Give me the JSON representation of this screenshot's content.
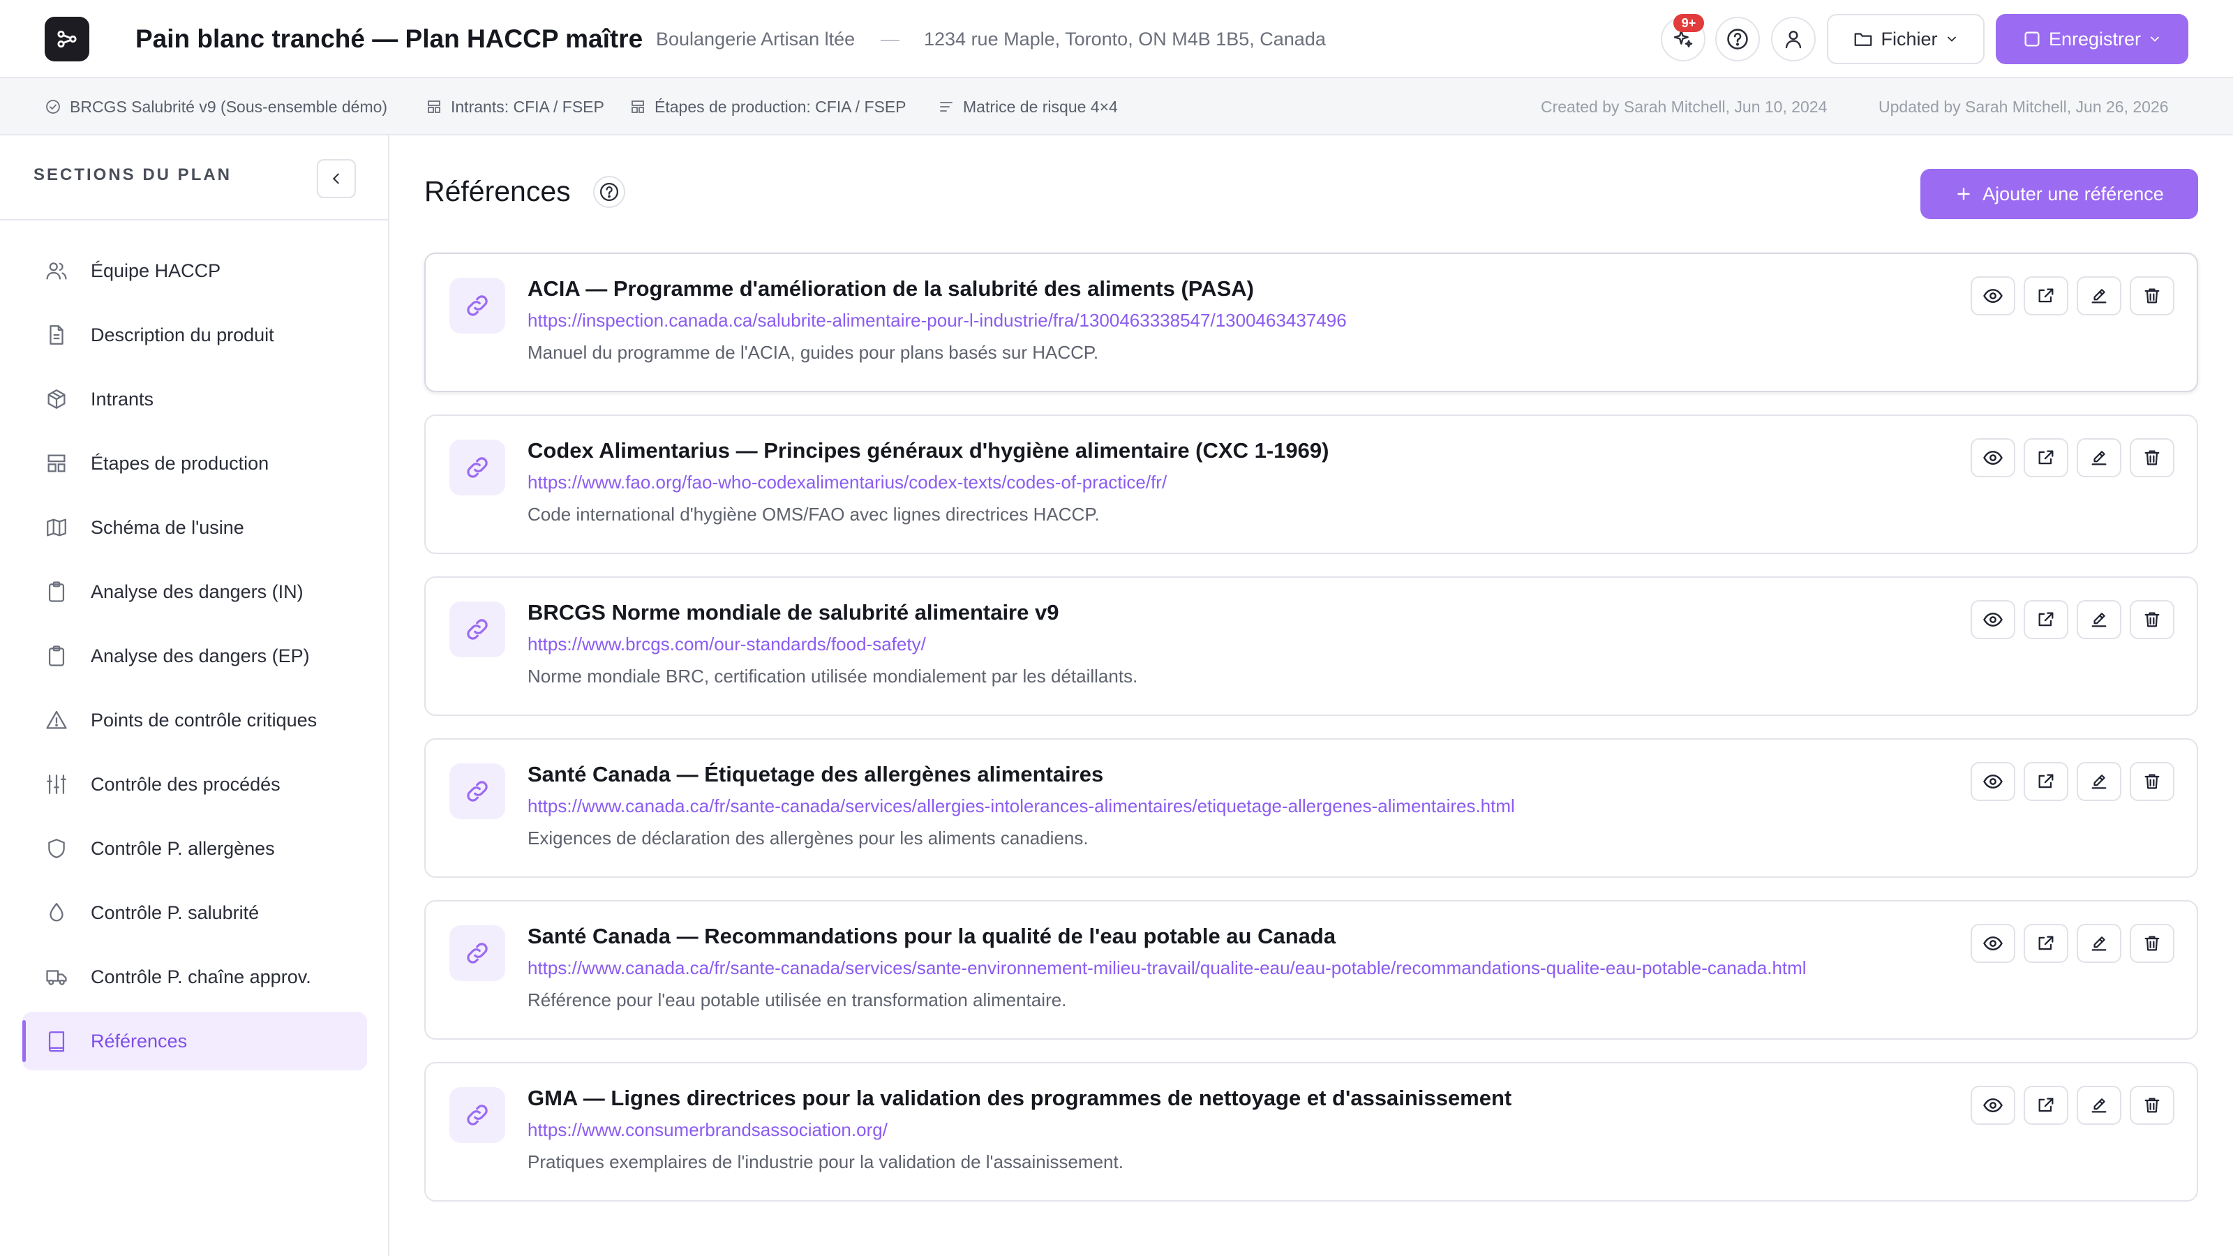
{
  "header": {
    "title": "Pain blanc tranché — Plan HACCP maître",
    "company": "Boulangerie Artisan ltée",
    "separator": "—",
    "address": "1234 rue Maple, Toronto, ON M4B 1B5, Canada",
    "notification_count": "9+",
    "file_label": "Fichier",
    "save_label": "Enregistrer"
  },
  "meta": {
    "standard": "BRCGS Salubrité v9 (Sous-ensemble démo)",
    "intrants": "Intrants: CFIA / FSEP",
    "etapes": "Étapes de production: CFIA / FSEP",
    "matrix": "Matrice de risque 4×4",
    "created": "Created by Sarah Mitchell, Jun 10, 2024",
    "updated": "Updated by Sarah Mitchell, Jun 26, 2026"
  },
  "sidebar": {
    "title": "SECTIONS DU PLAN",
    "items": [
      {
        "label": "Équipe HACCP",
        "icon": "users-icon"
      },
      {
        "label": "Description du produit",
        "icon": "document-icon"
      },
      {
        "label": "Intrants",
        "icon": "box-icon"
      },
      {
        "label": "Étapes de production",
        "icon": "layout-icon"
      },
      {
        "label": "Schéma de l'usine",
        "icon": "map-icon"
      },
      {
        "label": "Analyse des dangers (IN)",
        "icon": "clipboard-icon"
      },
      {
        "label": "Analyse des dangers (EP)",
        "icon": "clipboard-icon"
      },
      {
        "label": "Points de contrôle critiques",
        "icon": "warning-icon"
      },
      {
        "label": "Contrôle des procédés",
        "icon": "sliders-icon"
      },
      {
        "label": "Contrôle P. allergènes",
        "icon": "shield-icon"
      },
      {
        "label": "Contrôle P. salubrité",
        "icon": "droplet-icon"
      },
      {
        "label": "Contrôle P. chaîne approv.",
        "icon": "truck-icon"
      },
      {
        "label": "Références",
        "icon": "book-icon",
        "active": true
      }
    ]
  },
  "main": {
    "title": "Références",
    "add_label": "Ajouter une référence",
    "references": [
      {
        "title": "ACIA — Programme d'amélioration de la salubrité des aliments (PASA)",
        "url": "https://inspection.canada.ca/salubrite-alimentaire-pour-l-industrie/fra/1300463338547/1300463437496",
        "description": "Manuel du programme de l'ACIA, guides pour plans basés sur HACCP."
      },
      {
        "title": "Codex Alimentarius — Principes généraux d'hygiène alimentaire (CXC 1-1969)",
        "url": "https://www.fao.org/fao-who-codexalimentarius/codex-texts/codes-of-practice/fr/",
        "description": "Code international d'hygiène OMS/FAO avec lignes directrices HACCP."
      },
      {
        "title": "BRCGS Norme mondiale de salubrité alimentaire v9",
        "url": "https://www.brcgs.com/our-standards/food-safety/",
        "description": "Norme mondiale BRC, certification utilisée mondialement par les détaillants."
      },
      {
        "title": "Santé Canada — Étiquetage des allergènes alimentaires",
        "url": "https://www.canada.ca/fr/sante-canada/services/allergies-intolerances-alimentaires/etiquetage-allergenes-alimentaires.html",
        "description": "Exigences de déclaration des allergènes pour les aliments canadiens."
      },
      {
        "title": "Santé Canada — Recommandations pour la qualité de l'eau potable au Canada",
        "url": "https://www.canada.ca/fr/sante-canada/services/sante-environnement-milieu-travail/qualite-eau/eau-potable/recommandations-qualite-eau-potable-canada.html",
        "description": "Référence pour l'eau potable utilisée en transformation alimentaire."
      },
      {
        "title": "GMA — Lignes directrices pour la validation des programmes de nettoyage et d'assainissement",
        "url": "https://www.consumerbrandsassociation.org/",
        "description": "Pratiques exemplaires de l'industrie pour la validation de l'assainissement."
      }
    ]
  },
  "colors": {
    "accent": "#9b6bf2",
    "accent_light": "#f2ecfe",
    "link": "#8b5cf0",
    "badge": "#e23b3b"
  }
}
